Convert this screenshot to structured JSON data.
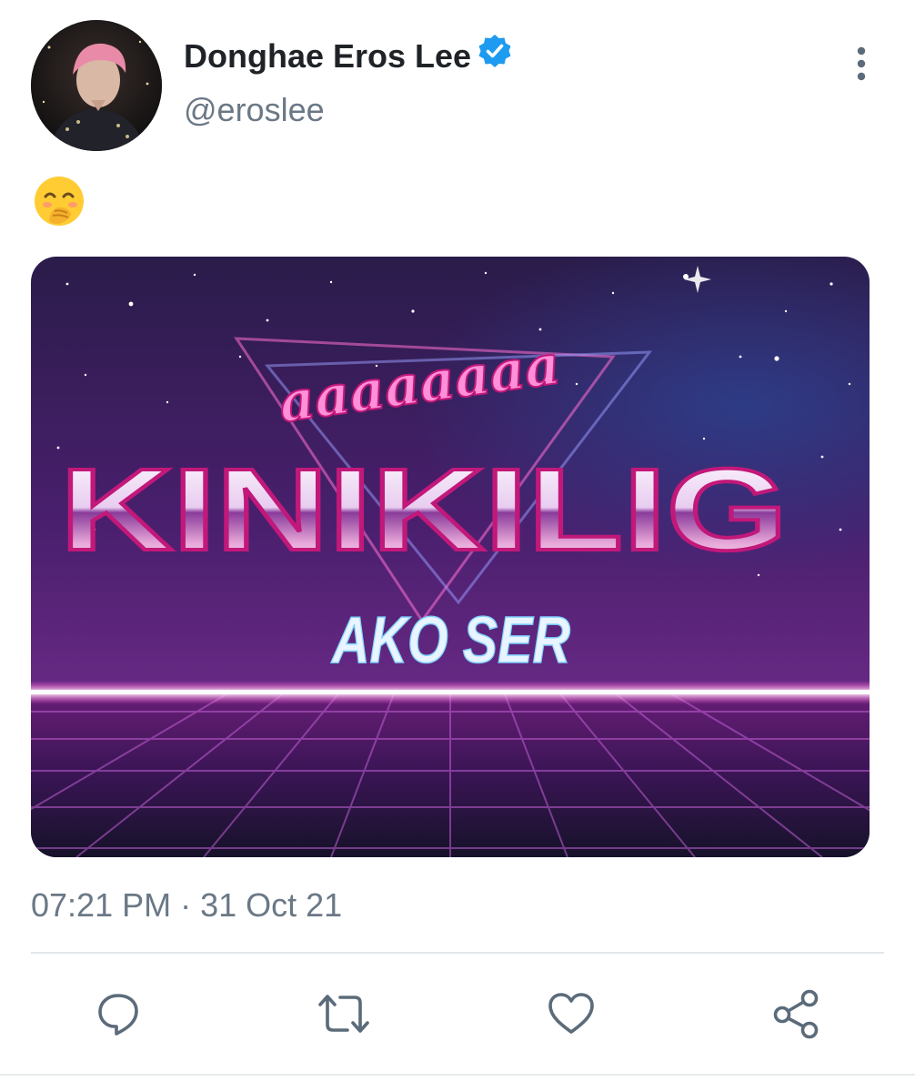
{
  "tweet": {
    "display_name": "Donghae Eros Lee",
    "handle": "@eroslee",
    "verified": true,
    "emoji": "🤭",
    "media": {
      "top_text": "aaaaaaaa",
      "main_text": "KINIKILIG",
      "sub_text": "AKO SER"
    },
    "timestamp": "07:21 PM · 31 Oct 21"
  },
  "icons": {
    "verified": "verified-badge-icon",
    "more": "more-vertical-icon",
    "reply": "reply-icon",
    "retweet": "retweet-icon",
    "like": "heart-icon",
    "share": "share-icon"
  },
  "colors": {
    "accent": "#1d9bf0",
    "icon_gray": "#5b6b7a",
    "name": "#1f2328",
    "secondary": "#6b7886"
  }
}
